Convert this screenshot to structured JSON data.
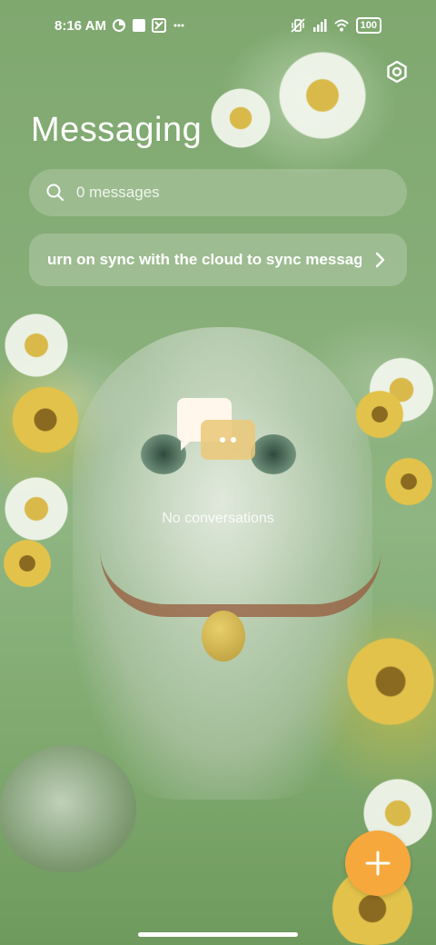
{
  "status_bar": {
    "time": "8:16 AM",
    "battery": "100"
  },
  "header": {
    "title": "Messaging"
  },
  "search": {
    "placeholder": "0 messages"
  },
  "sync_banner": {
    "text": "urn on sync with the cloud to sync messag"
  },
  "empty_state": {
    "text": "No conversations"
  },
  "colors": {
    "fab": "#f7a83c",
    "accent_white": "#ffffff"
  },
  "icons": {
    "settings": "settings-icon",
    "search": "search-icon",
    "chevron": "chevron-right-icon",
    "fab": "plus-icon",
    "empty": "chat-bubbles-icon"
  }
}
